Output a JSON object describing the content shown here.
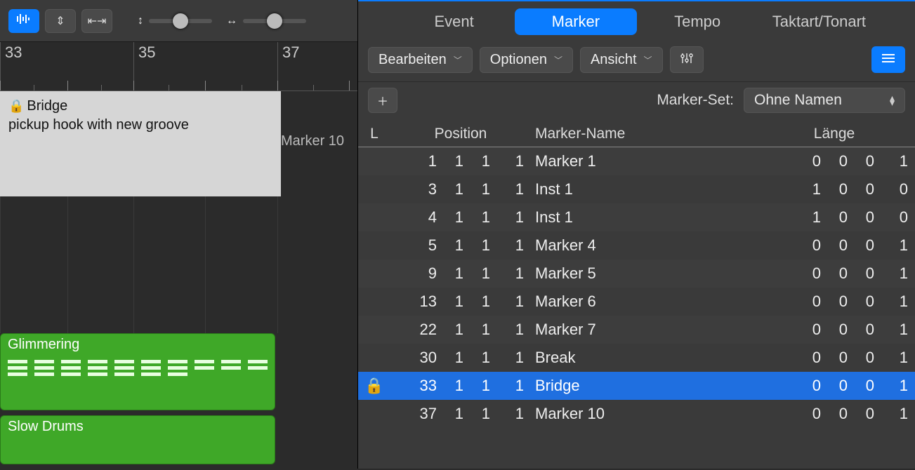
{
  "left": {
    "ruler_bars": [
      "33",
      "35",
      "37"
    ],
    "marker_region": {
      "title": "Bridge",
      "note": "pickup hook with new groove"
    },
    "marker_chip": "Marker 10",
    "clips": [
      {
        "name": "Glimmering"
      },
      {
        "name": "Slow Drums"
      }
    ]
  },
  "tabs": {
    "event": "Event",
    "marker": "Marker",
    "tempo": "Tempo",
    "taktart": "Taktart/Tonart"
  },
  "menus": {
    "edit": "Bearbeiten",
    "options": "Optionen",
    "view": "Ansicht"
  },
  "set": {
    "label": "Marker-Set:",
    "value": "Ohne Namen"
  },
  "columns": {
    "lock": "L",
    "position": "Position",
    "name": "Marker-Name",
    "length": "Länge"
  },
  "rows": [
    {
      "lock": "",
      "pos": [
        "1",
        "1",
        "1",
        "1"
      ],
      "name": "Marker 1",
      "len": [
        "0",
        "0",
        "0",
        "1"
      ],
      "selected": false
    },
    {
      "lock": "",
      "pos": [
        "3",
        "1",
        "1",
        "1"
      ],
      "name": "Inst 1",
      "len": [
        "1",
        "0",
        "0",
        "0"
      ],
      "selected": false
    },
    {
      "lock": "",
      "pos": [
        "4",
        "1",
        "1",
        "1"
      ],
      "name": "Inst 1",
      "len": [
        "1",
        "0",
        "0",
        "0"
      ],
      "selected": false
    },
    {
      "lock": "",
      "pos": [
        "5",
        "1",
        "1",
        "1"
      ],
      "name": "Marker 4",
      "len": [
        "0",
        "0",
        "0",
        "1"
      ],
      "selected": false
    },
    {
      "lock": "",
      "pos": [
        "9",
        "1",
        "1",
        "1"
      ],
      "name": "Marker 5",
      "len": [
        "0",
        "0",
        "0",
        "1"
      ],
      "selected": false
    },
    {
      "lock": "",
      "pos": [
        "13",
        "1",
        "1",
        "1"
      ],
      "name": "Marker 6",
      "len": [
        "0",
        "0",
        "0",
        "1"
      ],
      "selected": false
    },
    {
      "lock": "",
      "pos": [
        "22",
        "1",
        "1",
        "1"
      ],
      "name": "Marker 7",
      "len": [
        "0",
        "0",
        "0",
        "1"
      ],
      "selected": false
    },
    {
      "lock": "",
      "pos": [
        "30",
        "1",
        "1",
        "1"
      ],
      "name": "Break",
      "len": [
        "0",
        "0",
        "0",
        "1"
      ],
      "selected": false
    },
    {
      "lock": "🔒",
      "pos": [
        "33",
        "1",
        "1",
        "1"
      ],
      "name": "Bridge",
      "len": [
        "0",
        "0",
        "0",
        "1"
      ],
      "selected": true
    },
    {
      "lock": "",
      "pos": [
        "37",
        "1",
        "1",
        "1"
      ],
      "name": "Marker 10",
      "len": [
        "0",
        "0",
        "0",
        "1"
      ],
      "selected": false
    }
  ]
}
